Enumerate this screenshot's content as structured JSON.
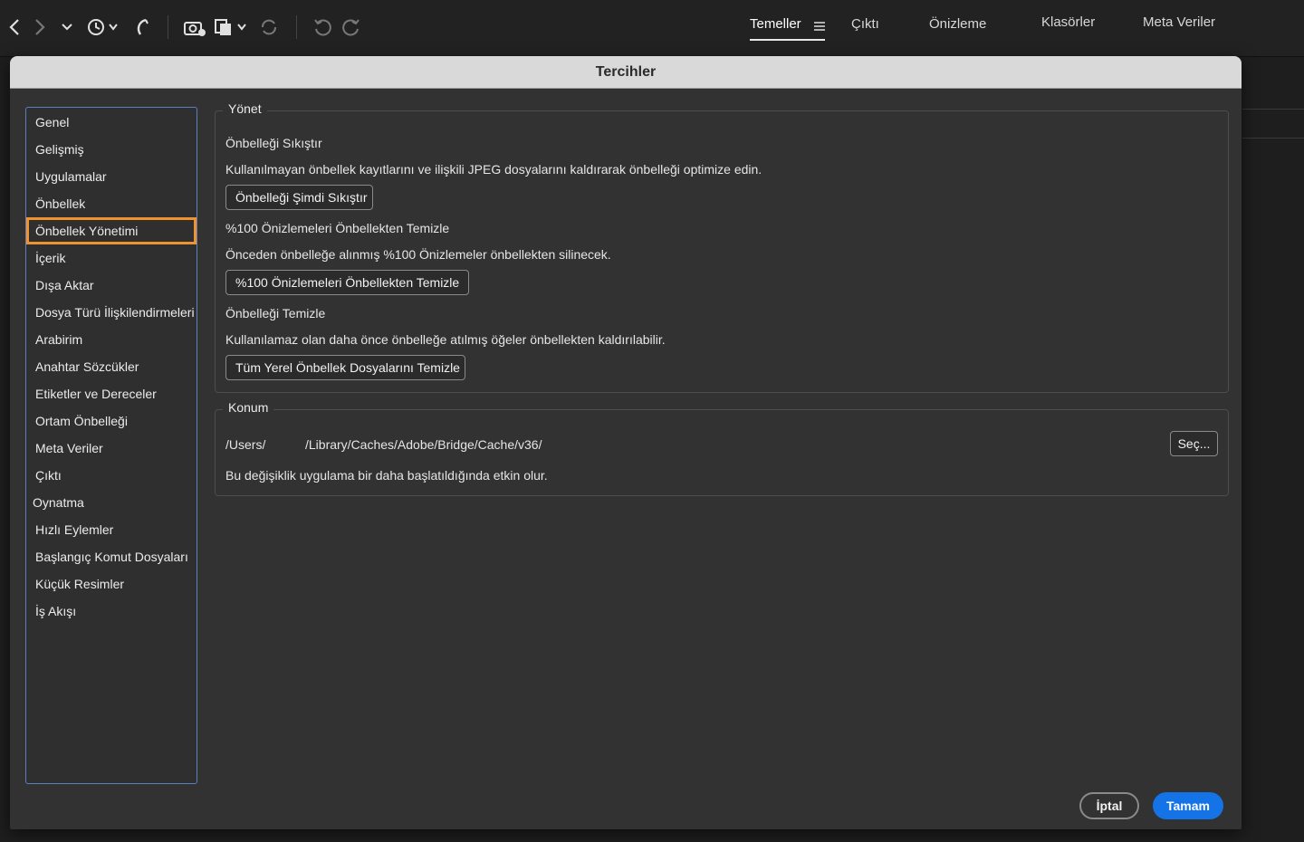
{
  "workspaces": {
    "tabs": [
      {
        "label": "Temeller"
      },
      {
        "label": "Çıktı"
      },
      {
        "label": "Önizleme"
      },
      {
        "label": "Klasörler"
      },
      {
        "label": "Meta Veriler"
      }
    ],
    "active": "Temeller"
  },
  "toolbar_icons": [
    "back-icon",
    "forward-icon",
    "chevron-down-icon",
    "history-icon",
    "boomerang-icon",
    "camera-import-icon",
    "copy-icon",
    "refresh-icon",
    "rotate-left-icon",
    "rotate-right-icon",
    "menu-icon"
  ],
  "dialog": {
    "title": "Tercihler",
    "sidebar": {
      "items": [
        {
          "label": "Genel"
        },
        {
          "label": "Gelişmiş"
        },
        {
          "label": "Uygulamalar"
        },
        {
          "label": "Önbellek"
        },
        {
          "label": "Önbellek Yönetimi"
        },
        {
          "label": "İçerik"
        },
        {
          "label": "Dışa Aktar"
        },
        {
          "label": "Dosya Türü İlişkilendirmeleri"
        },
        {
          "label": "Arabirim"
        },
        {
          "label": "Anahtar Sözcükler"
        },
        {
          "label": "Etiketler ve Dereceler"
        },
        {
          "label": "Ortam Önbelleği"
        },
        {
          "label": "Meta Veriler"
        },
        {
          "label": "Çıktı"
        },
        {
          "label": "Oynatma"
        },
        {
          "label": "Hızlı Eylemler"
        },
        {
          "label": "Başlangıç Komut Dosyaları"
        },
        {
          "label": "Küçük Resimler"
        },
        {
          "label": "İş Akışı"
        }
      ],
      "selected": "Önbellek Yönetimi"
    },
    "manage": {
      "label": "Yönet",
      "compact": {
        "title": "Önbelleği Sıkıştır",
        "desc": "Kullanılmayan önbellek kayıtlarını ve ilişkili JPEG dosyalarını kaldırarak önbelleği optimize edin.",
        "button": "Önbelleği Şimdi Sıkıştır"
      },
      "purge100": {
        "title": "%100 Önizlemeleri Önbellekten Temizle",
        "desc": "Önceden önbelleğe alınmış %100 Önizlemeler önbellekten silinecek.",
        "button": "%100 Önizlemeleri Önbellekten Temizle"
      },
      "purge": {
        "title": "Önbelleği Temizle",
        "desc": "Kullanılamaz olan daha önce önbelleğe atılmış öğeler önbellekten kaldırılabilir.",
        "button": "Tüm Yerel Önbellek Dosyalarını Temizle"
      }
    },
    "location": {
      "label": "Konum",
      "path_prefix": "/Users/",
      "path_suffix": "/Library/Caches/Adobe/Bridge/Cache/v36/",
      "choose_button": "Seç...",
      "note": "Bu değişiklik uygulama bir daha başlatıldığında etkin olur."
    },
    "cancel_button": "İptal",
    "ok_button": "Tamam"
  }
}
